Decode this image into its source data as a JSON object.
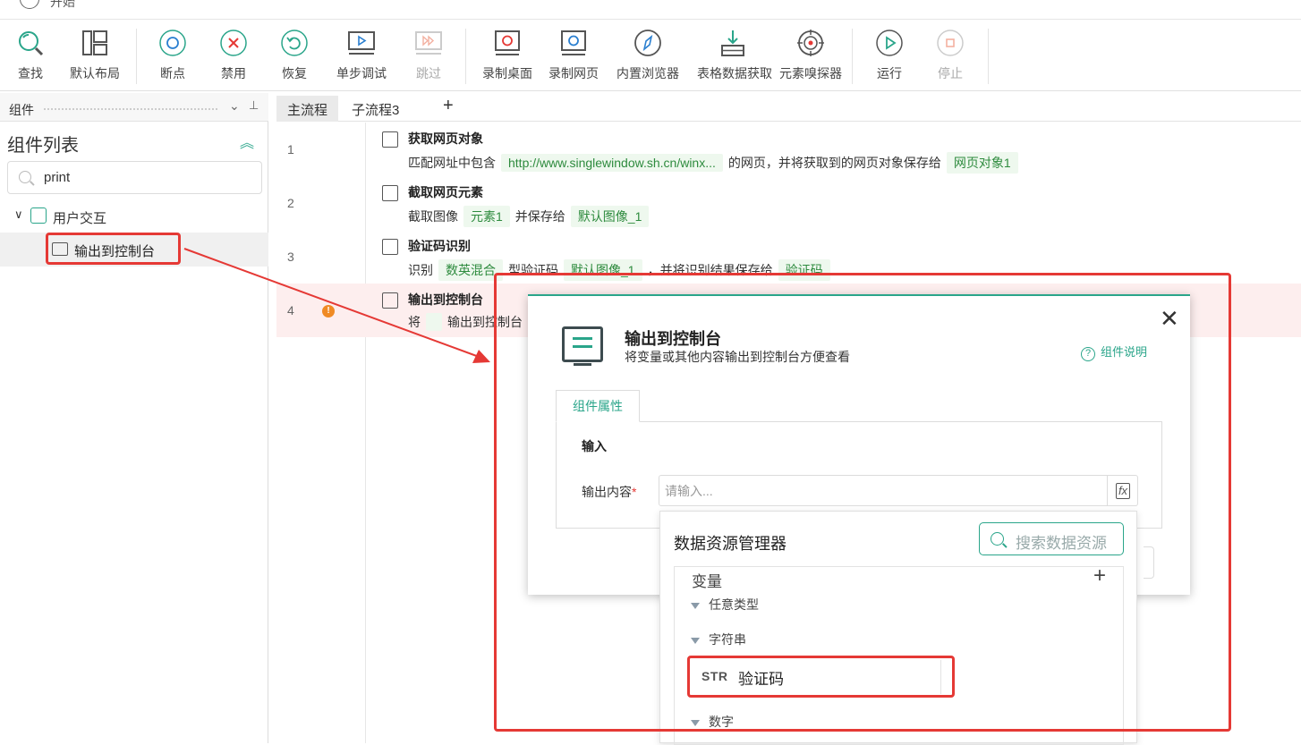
{
  "topbar": {
    "back_label": "开始"
  },
  "toolbar": {
    "items": [
      {
        "label": "查找",
        "icon": "search-icon"
      },
      {
        "label": "默认布局",
        "icon": "layout-icon"
      },
      {
        "label": "断点",
        "icon": "breakpoint-icon"
      },
      {
        "label": "禁用",
        "icon": "disable-icon"
      },
      {
        "label": "恢复",
        "icon": "restore-icon"
      },
      {
        "label": "单步调试",
        "icon": "step-debug-icon"
      },
      {
        "label": "跳过",
        "icon": "skip-icon",
        "disabled": true
      },
      {
        "label": "录制桌面",
        "icon": "record-desktop-icon"
      },
      {
        "label": "录制网页",
        "icon": "record-web-icon"
      },
      {
        "label": "内置浏览器",
        "icon": "browser-icon"
      },
      {
        "label": "表格数据获取",
        "icon": "table-data-icon"
      },
      {
        "label": "元素嗅探器",
        "icon": "element-sniffer-icon"
      },
      {
        "label": "运行",
        "icon": "run-icon"
      },
      {
        "label": "停止",
        "icon": "stop-icon",
        "disabled": true
      }
    ]
  },
  "left_panel": {
    "header": "组件",
    "title": "组件列表",
    "search_value": "print",
    "category": "用户交互",
    "item": "输出到控制台"
  },
  "tabs": {
    "main": "主流程",
    "sub": "子流程3",
    "add": "+"
  },
  "flow": {
    "steps": [
      {
        "num": "1",
        "title": "获取网页对象",
        "parts": [
          "匹配网址中包含",
          {
            "chip": "http://www.singlewindow.sh.cn/winx..."
          },
          "的网页，并将获取到的网页对象保存给",
          {
            "chip": "网页对象1"
          }
        ]
      },
      {
        "num": "2",
        "title": "截取网页元素",
        "parts": [
          "截取图像",
          {
            "chip": "元素1"
          },
          "并保存给",
          {
            "chip": "默认图像_1"
          }
        ]
      },
      {
        "num": "3",
        "title": "验证码识别",
        "parts": [
          "识别",
          {
            "chip": "数英混合"
          },
          "型验证码",
          {
            "chip": "默认图像_1"
          },
          "，并将识别结果保存给",
          {
            "chip": "验证码"
          }
        ]
      },
      {
        "num": "4",
        "title": "输出到控制台",
        "warning": "!",
        "parts": [
          "将",
          {
            "chip": ""
          },
          "输出到控制台"
        ]
      }
    ]
  },
  "dialog": {
    "title": "输出到控制台",
    "subtitle": "将变量或其他内容输出到控制台方便查看",
    "help": "组件说明",
    "help_q": "?",
    "tab": "组件属性",
    "section": "输入",
    "field_label": "输出内容",
    "required_mark": "*",
    "field_placeholder": "请输入...",
    "fx": "fx",
    "close": "✕"
  },
  "data_manager": {
    "title": "数据资源管理器",
    "search_placeholder": "搜索数据资源",
    "variables_label": "变量",
    "add": "+",
    "groups": [
      "任意类型",
      "字符串",
      "数字"
    ],
    "string_var": {
      "type_tag": "STR",
      "name": "验证码"
    }
  },
  "colors": {
    "accent": "#2aa58a",
    "annotation_red": "#e53935",
    "chip_bg": "#eef8ee",
    "chip_text": "#2e8b3e"
  }
}
